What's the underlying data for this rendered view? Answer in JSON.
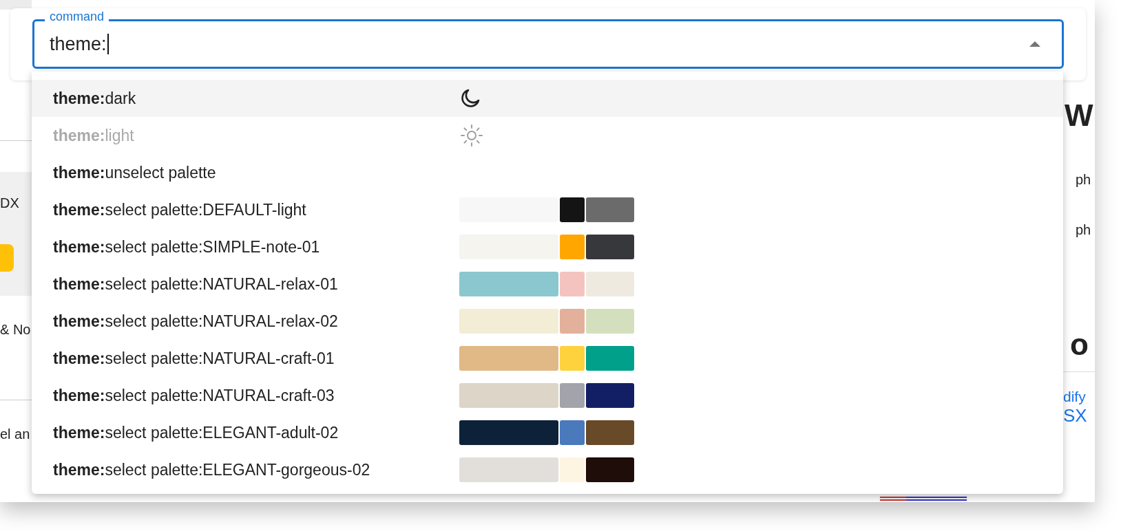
{
  "background": {
    "left_texts": [
      "DX",
      "& No",
      "el an"
    ],
    "right_heading": "W",
    "right_texts": [
      "ph",
      "ph"
    ],
    "right_heading_2": "o",
    "right_links": [
      "dify",
      "SX"
    ]
  },
  "command": {
    "label": "command",
    "value": "theme:",
    "expanded": true
  },
  "options": [
    {
      "text": "**theme:**dark",
      "selected": true,
      "disabled": false,
      "kind": "moon"
    },
    {
      "text": "**theme:**light",
      "selected": false,
      "disabled": true,
      "kind": "sun"
    },
    {
      "text": "**theme:**unselect palette",
      "selected": false,
      "disabled": false,
      "kind": "text"
    },
    {
      "text": "**theme:**select palette:DEFAULT-light",
      "selected": false,
      "disabled": false,
      "kind": "palette",
      "swatches": [
        {
          "color": "#f7f7f7"
        },
        {
          "color": "#141414"
        },
        {
          "color": "#6b6b6b"
        }
      ]
    },
    {
      "text": "**theme:**select palette:SIMPLE-note-01",
      "selected": false,
      "disabled": false,
      "kind": "palette",
      "swatches": [
        {
          "color": "#f5f4ef"
        },
        {
          "color": "#ffa700"
        },
        {
          "color": "#37383c"
        }
      ]
    },
    {
      "text": "**theme:**select palette:NATURAL-relax-01",
      "selected": false,
      "disabled": false,
      "kind": "palette",
      "swatches": [
        {
          "color": "#8bc7cf"
        },
        {
          "color": "#f5c3bf"
        },
        {
          "color": "#eeeadf"
        }
      ]
    },
    {
      "text": "**theme:**select palette:NATURAL-relax-02",
      "selected": false,
      "disabled": false,
      "kind": "palette",
      "swatches": [
        {
          "color": "#f3edd6"
        },
        {
          "color": "#e3b09b"
        },
        {
          "color": "#d4e0bd"
        }
      ]
    },
    {
      "text": "**theme:**select palette:NATURAL-craft-01",
      "selected": false,
      "disabled": false,
      "kind": "palette",
      "swatches": [
        {
          "color": "#e0b986"
        },
        {
          "color": "#fdd23d"
        },
        {
          "color": "#00a08b"
        }
      ]
    },
    {
      "text": "**theme:**select palette:NATURAL-craft-03",
      "selected": false,
      "disabled": false,
      "kind": "palette",
      "swatches": [
        {
          "color": "#ddd5c8"
        },
        {
          "color": "#a3a3ab"
        },
        {
          "color": "#121f64"
        }
      ]
    },
    {
      "text": "**theme:**select palette:ELEGANT-adult-02",
      "selected": false,
      "disabled": false,
      "kind": "palette",
      "swatches": [
        {
          "color": "#0d2238"
        },
        {
          "color": "#4a79bc"
        },
        {
          "color": "#684a29"
        }
      ]
    },
    {
      "text": "**theme:**select palette:ELEGANT-gorgeous-02",
      "selected": false,
      "disabled": false,
      "kind": "palette",
      "swatches": [
        {
          "color": "#e2dfdb"
        },
        {
          "color": "#fdf4e2"
        },
        {
          "color": "#1e0d08"
        }
      ]
    }
  ]
}
